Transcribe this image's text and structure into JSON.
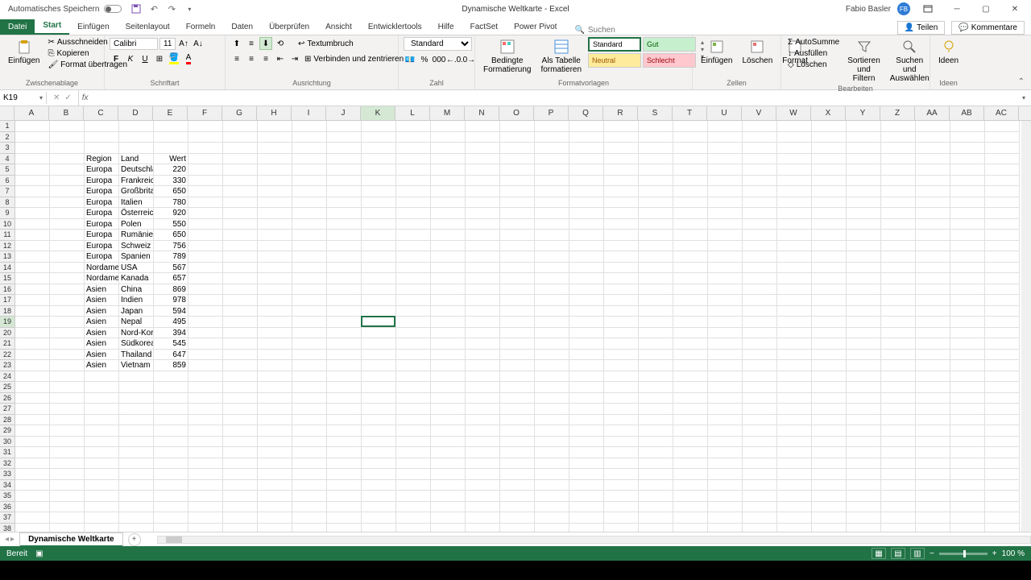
{
  "title": {
    "autosave": "Automatisches Speichern",
    "doc": "Dynamische Weltkarte",
    "app": "Excel",
    "user": "Fabio Basler",
    "initials": "FB"
  },
  "tabs": {
    "file": "Datei",
    "items": [
      "Start",
      "Einfügen",
      "Seitenlayout",
      "Formeln",
      "Daten",
      "Überprüfen",
      "Ansicht",
      "Entwicklertools",
      "Hilfe",
      "FactSet",
      "Power Pivot"
    ],
    "active": 0,
    "search": "Suchen",
    "share": "Teilen",
    "comments": "Kommentare"
  },
  "ribbon": {
    "clipboard": {
      "paste": "Einfügen",
      "cut": "Ausschneiden",
      "copy": "Kopieren",
      "format": "Format übertragen",
      "label": "Zwischenablage"
    },
    "font": {
      "name": "Calibri",
      "size": "11",
      "label": "Schriftart"
    },
    "align": {
      "wrap": "Textumbruch",
      "merge": "Verbinden und zentrieren",
      "label": "Ausrichtung"
    },
    "number": {
      "format": "Standard",
      "label": "Zahl"
    },
    "styles": {
      "cond": "Bedingte\nFormatierung",
      "table": "Als Tabelle\nformatieren",
      "standard": "Standard",
      "gut": "Gut",
      "neutral": "Neutral",
      "schlecht": "Schlecht",
      "label": "Formatvorlagen"
    },
    "cells": {
      "insert": "Einfügen",
      "delete": "Löschen",
      "format": "Format",
      "label": "Zellen"
    },
    "editing": {
      "autosum": "AutoSumme",
      "fill": "Ausfüllen",
      "clear": "Löschen",
      "sort": "Sortieren und\nFiltern",
      "find": "Suchen und\nAuswählen",
      "label": "Bearbeiten"
    },
    "ideas": {
      "btn": "Ideen",
      "label": "Ideen"
    }
  },
  "namebox": "K19",
  "columns": [
    "A",
    "B",
    "C",
    "D",
    "E",
    "F",
    "G",
    "H",
    "I",
    "J",
    "K",
    "L",
    "M",
    "N",
    "O",
    "P",
    "Q",
    "R",
    "S",
    "T",
    "U",
    "V",
    "W",
    "X",
    "Y",
    "Z",
    "AA",
    "AB",
    "AC"
  ],
  "selected_col": 10,
  "selected_row": 18,
  "active_cell": {
    "col": 10,
    "row": 18
  },
  "data": {
    "headers": {
      "row": 3,
      "C": "Region",
      "D": "Land",
      "E": "Wert"
    },
    "rows": [
      {
        "r": 4,
        "C": "Europa",
        "D": "Deutschla",
        "E": 220
      },
      {
        "r": 5,
        "C": "Europa",
        "D": "Frankreic",
        "E": 330
      },
      {
        "r": 6,
        "C": "Europa",
        "D": "Großbrita",
        "E": 650
      },
      {
        "r": 7,
        "C": "Europa",
        "D": "Italien",
        "E": 780
      },
      {
        "r": 8,
        "C": "Europa",
        "D": "Österreicl",
        "E": 920
      },
      {
        "r": 9,
        "C": "Europa",
        "D": "Polen",
        "E": 550
      },
      {
        "r": 10,
        "C": "Europa",
        "D": "Rumänien",
        "E": 650
      },
      {
        "r": 11,
        "C": "Europa",
        "D": "Schweiz",
        "E": 756
      },
      {
        "r": 12,
        "C": "Europa",
        "D": "Spanien",
        "E": 789
      },
      {
        "r": 13,
        "C": "Nordamer",
        "D": "USA",
        "E": 567
      },
      {
        "r": 14,
        "C": "Nordamer",
        "D": "Kanada",
        "E": 657
      },
      {
        "r": 15,
        "C": "Asien",
        "D": "China",
        "E": 869
      },
      {
        "r": 16,
        "C": "Asien",
        "D": "Indien",
        "E": 978
      },
      {
        "r": 17,
        "C": "Asien",
        "D": "Japan",
        "E": 594
      },
      {
        "r": 18,
        "C": "Asien",
        "D": "Nepal",
        "E": 495
      },
      {
        "r": 19,
        "C": "Asien",
        "D": "Nord-Kore",
        "E": 394
      },
      {
        "r": 20,
        "C": "Asien",
        "D": "Südkorea",
        "E": 545
      },
      {
        "r": 21,
        "C": "Asien",
        "D": "Thailand",
        "E": 647
      },
      {
        "r": 22,
        "C": "Asien",
        "D": "Vietnam",
        "E": 859
      }
    ]
  },
  "sheet": {
    "name": "Dynamische Weltkarte"
  },
  "status": {
    "ready": "Bereit",
    "zoom": "100 %"
  }
}
